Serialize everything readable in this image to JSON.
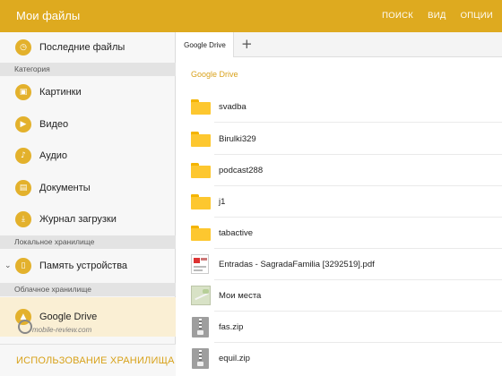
{
  "app": {
    "title": "Мои файлы",
    "actions": [
      "ПОИСК",
      "ВИД",
      "ОПЦИИ"
    ],
    "accent": "#deaa1f"
  },
  "sidebar": {
    "recent": {
      "label": "Последние файлы",
      "icon": "clock-icon"
    },
    "sections": [
      {
        "header": "Категория",
        "items": [
          {
            "label": "Картинки",
            "icon": "image-icon"
          },
          {
            "label": "Видео",
            "icon": "video-icon"
          },
          {
            "label": "Аудио",
            "icon": "music-icon"
          },
          {
            "label": "Документы",
            "icon": "document-icon"
          },
          {
            "label": "Журнал загрузки",
            "icon": "download-history-icon"
          }
        ]
      },
      {
        "header": "Локальное хранилище",
        "items": [
          {
            "label": "Память устройства",
            "icon": "device-storage-icon",
            "expandable": true
          }
        ]
      },
      {
        "header": "Облачное хранилище",
        "items": [
          {
            "label": "Google Drive",
            "icon": "google-drive-icon",
            "selected": true
          }
        ]
      }
    ],
    "bottom_action": "ИСПОЛЬЗОВАНИЕ ХРАНИЛИЩА",
    "watermark": "mobile-review.com"
  },
  "tabs": {
    "items": [
      {
        "label": "Google Drive",
        "active": true
      }
    ],
    "add_icon": "plus-icon"
  },
  "main": {
    "breadcrumb": "Google Drive",
    "files": [
      {
        "name": "svadba",
        "type": "folder"
      },
      {
        "name": "Birulki329",
        "type": "folder"
      },
      {
        "name": "podcast288",
        "type": "folder"
      },
      {
        "name": "j1",
        "type": "folder"
      },
      {
        "name": "tabactive",
        "type": "folder"
      },
      {
        "name": "Entradas - SagradaFamilia [3292519].pdf",
        "type": "pdf"
      },
      {
        "name": "Мои места",
        "type": "map"
      },
      {
        "name": "fas.zip",
        "type": "zip"
      },
      {
        "name": "equil.zip",
        "type": "zip"
      }
    ]
  }
}
